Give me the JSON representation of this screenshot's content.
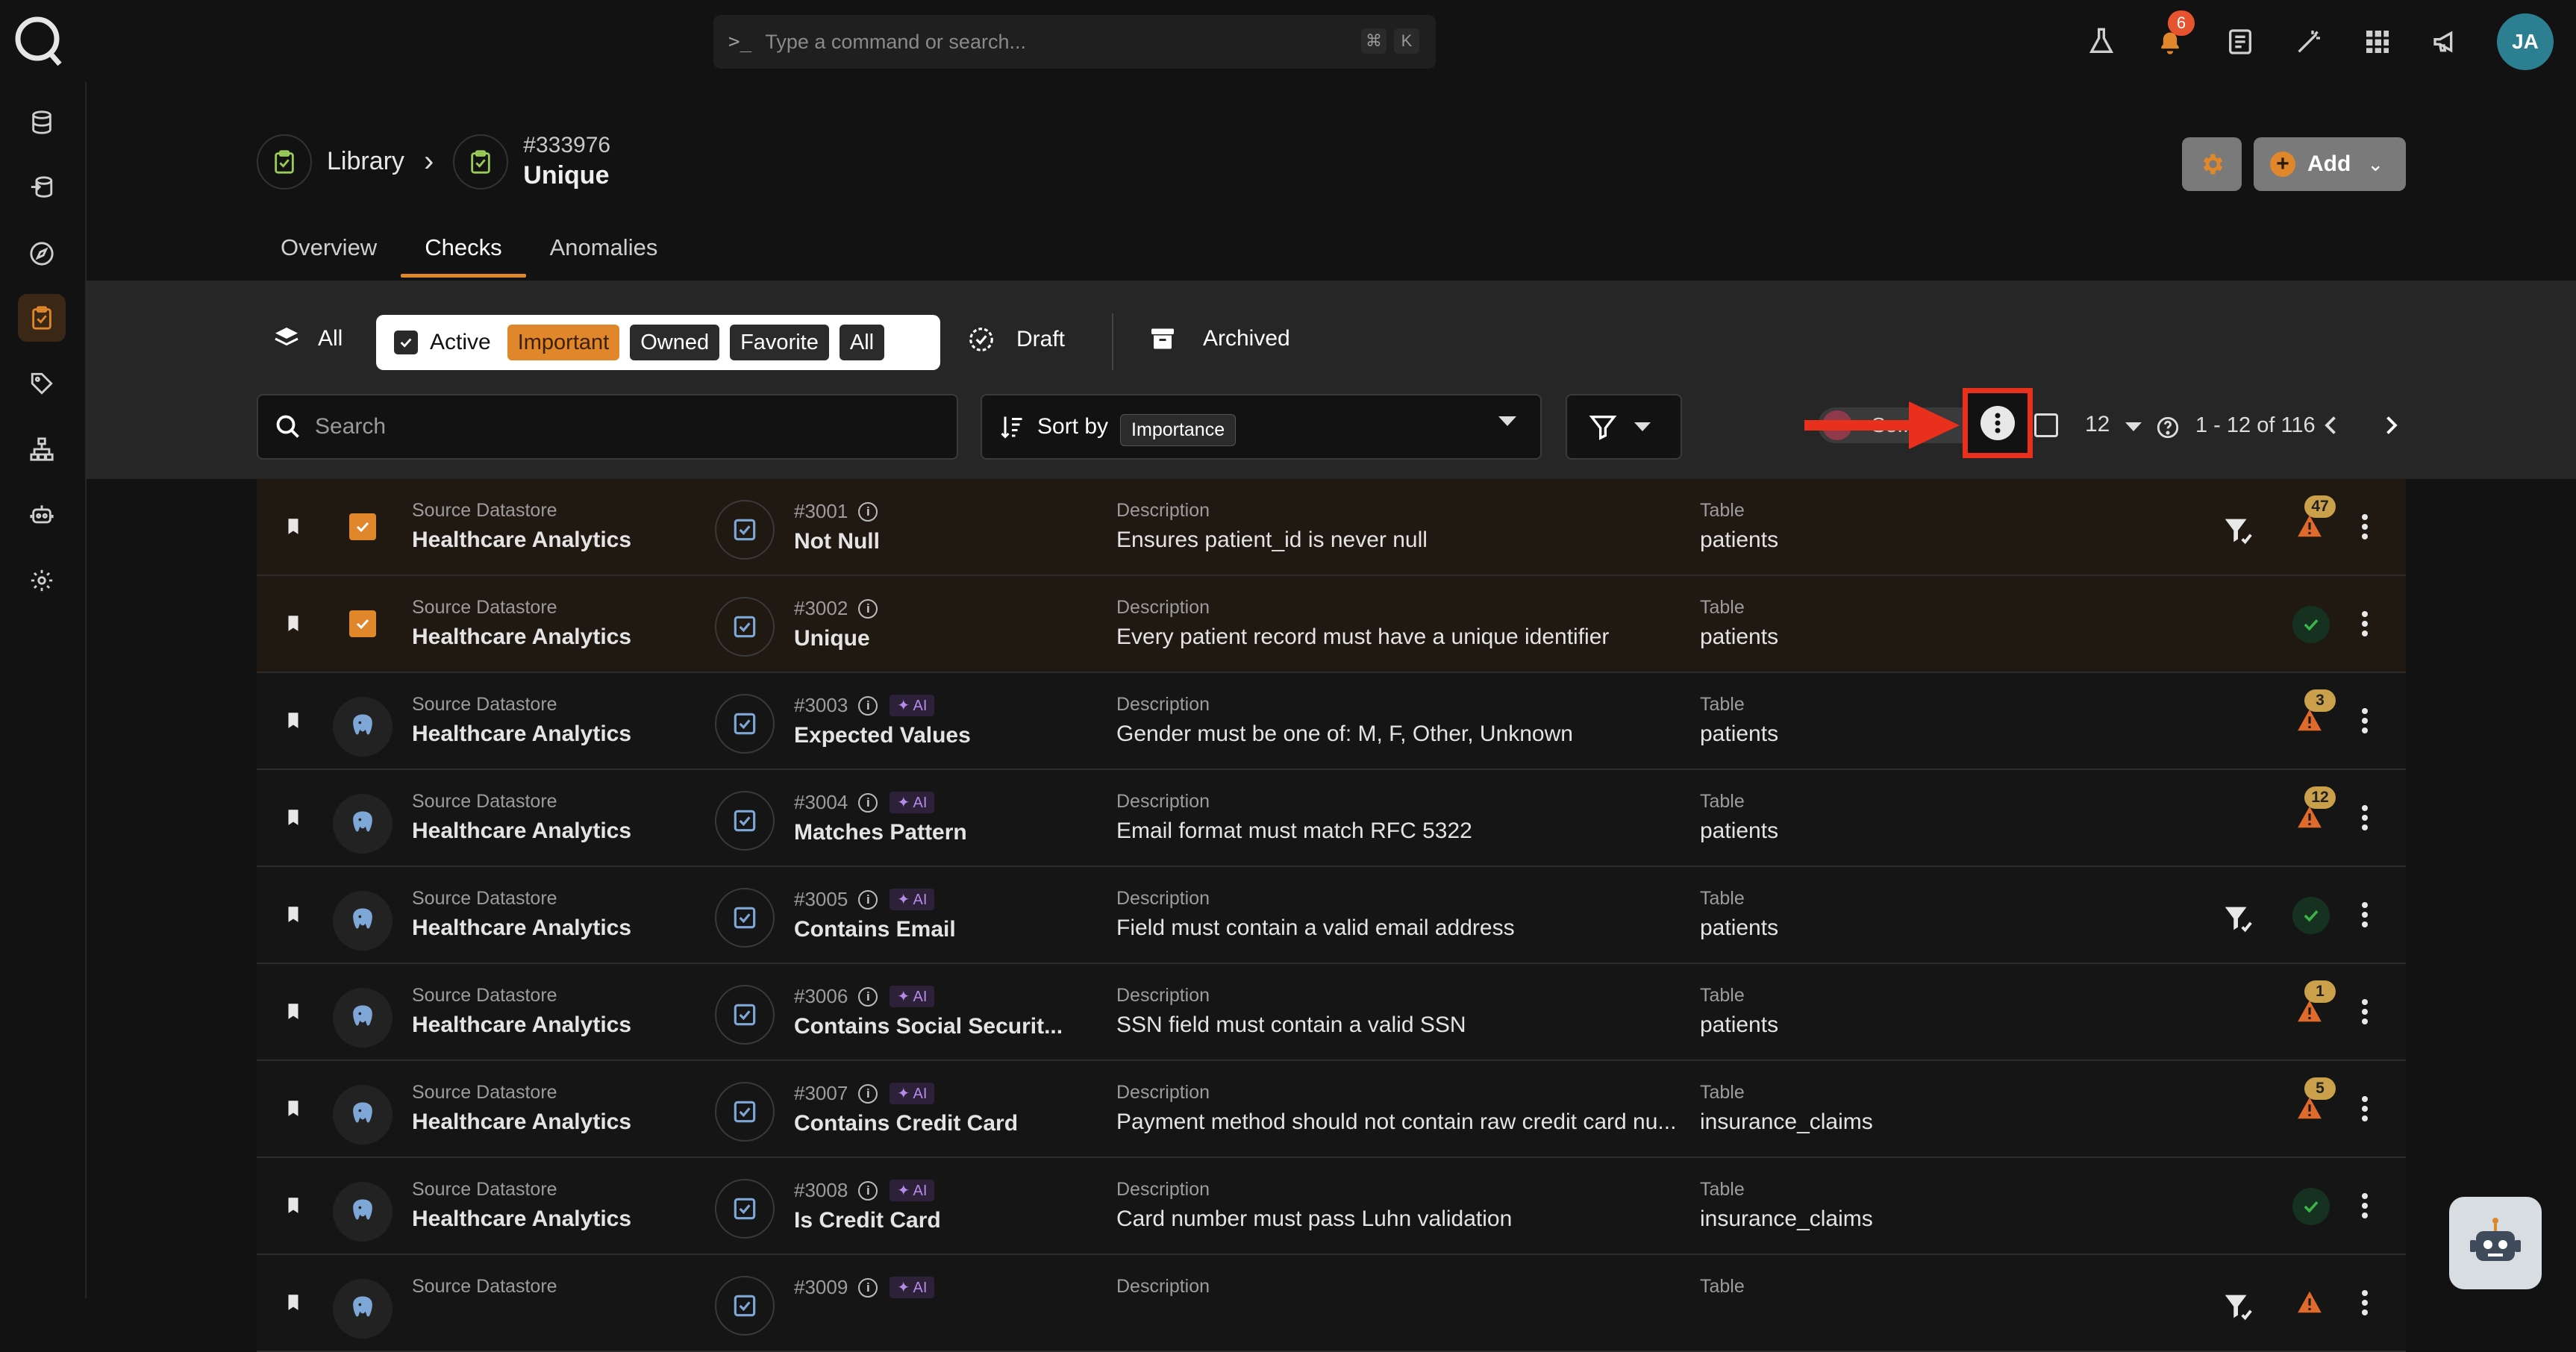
{
  "command": {
    "placeholder": "Type a command or search...",
    "key1": "⌘",
    "key2": "K"
  },
  "notifications": {
    "count": "6"
  },
  "user": {
    "initials": "JA"
  },
  "breadcrumb": {
    "root": "Library",
    "id": "#333976",
    "name": "Unique"
  },
  "actions": {
    "add_label": "Add"
  },
  "tabs": [
    "Overview",
    "Checks",
    "Anomalies"
  ],
  "filters": {
    "all": "All",
    "active": "Active",
    "chips": [
      "Important",
      "Owned",
      "Favorite",
      "All"
    ],
    "draft": "Draft",
    "archived": "Archived"
  },
  "toolbar": {
    "search_placeholder": "Search",
    "sort_label": "Sort by",
    "sort_value": "Importance",
    "toggle_text": "Se...ed",
    "per_page": "12",
    "range": "1 - 12 of 116"
  },
  "labels": {
    "source": "Source Datastore",
    "description": "Description",
    "table": "Table",
    "ai": "✦ AI"
  },
  "rows": [
    {
      "ds": "Healthcare Analytics",
      "id": "#3001",
      "name": "Not Null",
      "ai": false,
      "desc": "Ensures patient_id is never null",
      "table": "patients",
      "status": "anomaly",
      "count": "47",
      "filter": true,
      "selected": true
    },
    {
      "ds": "Healthcare Analytics",
      "id": "#3002",
      "name": "Unique",
      "ai": false,
      "desc": "Every patient record must have a unique identifier",
      "table": "patients",
      "status": "ok",
      "count": "",
      "filter": false,
      "selected": true
    },
    {
      "ds": "Healthcare Analytics",
      "id": "#3003",
      "name": "Expected Values",
      "ai": true,
      "desc": "Gender must be one of: M, F, Other, Unknown",
      "table": "patients",
      "status": "anomaly",
      "count": "3",
      "filter": false,
      "selected": false
    },
    {
      "ds": "Healthcare Analytics",
      "id": "#3004",
      "name": "Matches Pattern",
      "ai": true,
      "desc": "Email format must match RFC 5322",
      "table": "patients",
      "status": "anomaly",
      "count": "12",
      "filter": false,
      "selected": false
    },
    {
      "ds": "Healthcare Analytics",
      "id": "#3005",
      "name": "Contains Email",
      "ai": true,
      "desc": "Field must contain a valid email address",
      "table": "patients",
      "status": "ok",
      "count": "",
      "filter": true,
      "selected": false
    },
    {
      "ds": "Healthcare Analytics",
      "id": "#3006",
      "name": "Contains Social Securit...",
      "ai": true,
      "desc": "SSN field must contain a valid SSN",
      "table": "patients",
      "status": "anomaly",
      "count": "1",
      "filter": false,
      "selected": false
    },
    {
      "ds": "Healthcare Analytics",
      "id": "#3007",
      "name": "Contains Credit Card",
      "ai": true,
      "desc": "Payment method should not contain raw credit card nu...",
      "table": "insurance_claims",
      "status": "anomaly",
      "count": "5",
      "filter": false,
      "selected": false
    },
    {
      "ds": "Healthcare Analytics",
      "id": "#3008",
      "name": "Is Credit Card",
      "ai": true,
      "desc": "Card number must pass Luhn validation",
      "table": "insurance_claims",
      "status": "ok",
      "count": "",
      "filter": false,
      "selected": false
    },
    {
      "ds": "",
      "id": "#3009",
      "name": "",
      "ai": true,
      "desc": "",
      "table": "",
      "status": "anomaly",
      "count": "",
      "filter": true,
      "selected": false
    }
  ],
  "colors": {
    "accent": "#e0872b",
    "highlight": "#e8301c",
    "ok": "#3bb54a",
    "warn": "#e0872b"
  }
}
